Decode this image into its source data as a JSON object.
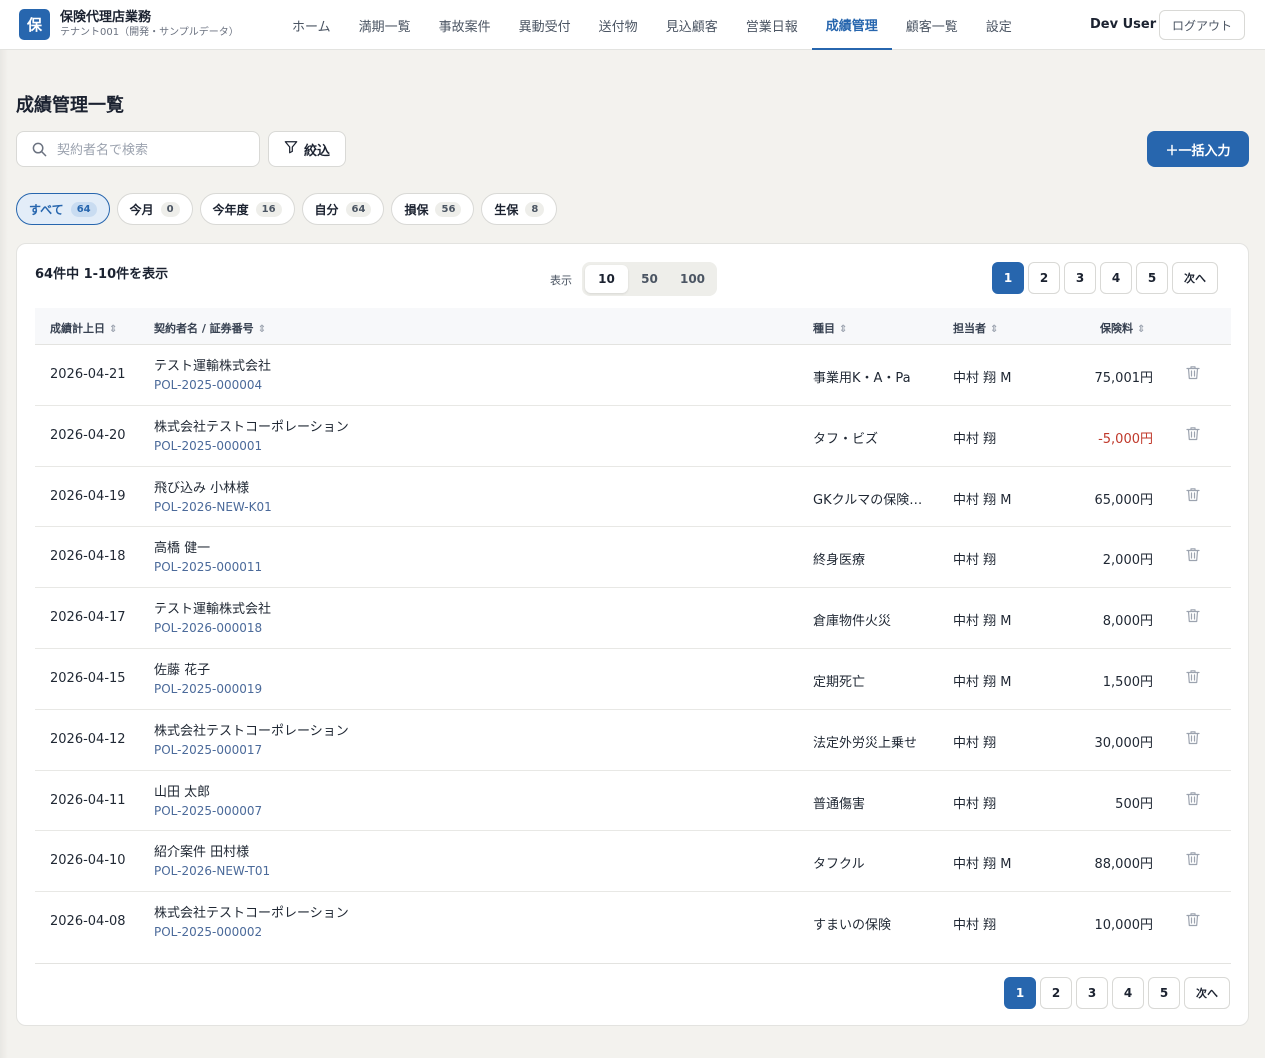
{
  "app": {
    "logo_char": "保",
    "title": "保険代理店業務",
    "subtitle": "テナント001（開発・サンプルデータ）"
  },
  "nav": {
    "items": [
      {
        "label": "ホーム"
      },
      {
        "label": "満期一覧"
      },
      {
        "label": "事故案件"
      },
      {
        "label": "異動受付"
      },
      {
        "label": "送付物"
      },
      {
        "label": "見込顧客"
      },
      {
        "label": "営業日報"
      },
      {
        "label": "成績管理",
        "active": true
      },
      {
        "label": "顧客一覧"
      },
      {
        "label": "設定"
      }
    ]
  },
  "user": {
    "name": "Dev User",
    "logout_label": "ログアウト"
  },
  "page": {
    "title": "成績管理一覧"
  },
  "toolbar": {
    "search_placeholder": "契約者名で検索",
    "filter_label": "絞込",
    "bulk_label": "＋一括入力"
  },
  "chips": [
    {
      "label": "すべて",
      "count": "64",
      "active": true
    },
    {
      "label": "今月",
      "count": "0"
    },
    {
      "label": "今年度",
      "count": "16"
    },
    {
      "label": "自分",
      "count": "64"
    },
    {
      "label": "損保",
      "count": "56"
    },
    {
      "label": "生保",
      "count": "8"
    }
  ],
  "results": {
    "summary": "64件中 1-10件を表示",
    "pagesize_label": "表示",
    "pagesize_options": [
      "10",
      "50",
      "100"
    ],
    "pagesize_selected": "10"
  },
  "pagination": {
    "pages": [
      "1",
      "2",
      "3",
      "4",
      "5"
    ],
    "current": "1",
    "next_label": "次へ"
  },
  "table": {
    "headers": {
      "date": "成績計上日",
      "contract": "契約者名 / 証券番号",
      "type": "種目",
      "staff": "担当者",
      "premium": "保険料"
    },
    "rows": [
      {
        "date": "2026-04-21",
        "name": "テスト運輸株式会社",
        "policy": "POL-2025-000004",
        "type": "事業用K・A・Pa",
        "staff": "中村 翔 M",
        "premium": "75,001円",
        "negative": false
      },
      {
        "date": "2026-04-20",
        "name": "株式会社テストコーポレーション",
        "policy": "POL-2025-000001",
        "type": "タフ・ビズ",
        "staff": "中村 翔",
        "premium": "-5,000円",
        "negative": true
      },
      {
        "date": "2026-04-19",
        "name": "飛び込み 小林様",
        "policy": "POL-2026-NEW-K01",
        "type": "GKクルマの保険…",
        "staff": "中村 翔 M",
        "premium": "65,000円",
        "negative": false
      },
      {
        "date": "2026-04-18",
        "name": "高橋 健一",
        "policy": "POL-2025-000011",
        "type": "終身医療",
        "staff": "中村 翔",
        "premium": "2,000円",
        "negative": false
      },
      {
        "date": "2026-04-17",
        "name": "テスト運輸株式会社",
        "policy": "POL-2026-000018",
        "type": "倉庫物件火災",
        "staff": "中村 翔 M",
        "premium": "8,000円",
        "negative": false
      },
      {
        "date": "2026-04-15",
        "name": "佐藤 花子",
        "policy": "POL-2025-000019",
        "type": "定期死亡",
        "staff": "中村 翔 M",
        "premium": "1,500円",
        "negative": false
      },
      {
        "date": "2026-04-12",
        "name": "株式会社テストコーポレーション",
        "policy": "POL-2025-000017",
        "type": "法定外労災上乗せ",
        "staff": "中村 翔",
        "premium": "30,000円",
        "negative": false
      },
      {
        "date": "2026-04-11",
        "name": "山田 太郎",
        "policy": "POL-2025-000007",
        "type": "普通傷害",
        "staff": "中村 翔",
        "premium": "500円",
        "negative": false
      },
      {
        "date": "2026-04-10",
        "name": "紹介案件 田村様",
        "policy": "POL-2026-NEW-T01",
        "type": "タフクル",
        "staff": "中村 翔 M",
        "premium": "88,000円",
        "negative": false
      },
      {
        "date": "2026-04-08",
        "name": "株式会社テストコーポレーション",
        "policy": "POL-2025-000002",
        "type": "すまいの保険",
        "staff": "中村 翔",
        "premium": "10,000円",
        "negative": false
      }
    ]
  },
  "icons": {
    "search": "search-icon",
    "filter": "filter-icon",
    "sort": "sort-icon",
    "delete": "trash-icon"
  },
  "colors": {
    "accent": "#2766ae",
    "negative": "#c0392b",
    "background": "#f3f2ee"
  }
}
